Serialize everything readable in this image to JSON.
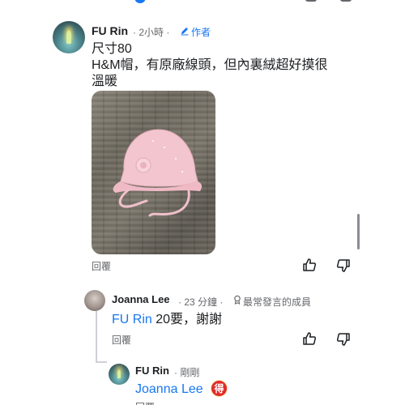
{
  "comments": [
    {
      "author": "FU Rin",
      "time": "· 2小時 ·",
      "author_badge": "作者",
      "lines": [
        "尺寸80",
        "H&M帽，有原廠線頭，但內裏絨超好摸很",
        "溫暖"
      ],
      "photo_desc": "pink knit baby hat on wood floor",
      "reply_label": "回覆"
    },
    {
      "author": "Joanna Lee",
      "time": "· 23 分鐘 ·",
      "badge": "最常發言的成員",
      "mention": "FU Rin",
      "text": " 20要，謝謝",
      "reply_label": "回覆"
    },
    {
      "author": "FU Rin",
      "time": "· 剛剛",
      "mention": "Joanna Lee",
      "emoji_label": "得"
    }
  ],
  "icons": {
    "like": "thumbs-up-icon",
    "dislike": "thumbs-down-icon",
    "edit": "pencil-icon",
    "member": "award-icon"
  },
  "colors": {
    "link": "#1877f2",
    "meta": "#65676b",
    "emoji_badge": "#e02b2b"
  }
}
